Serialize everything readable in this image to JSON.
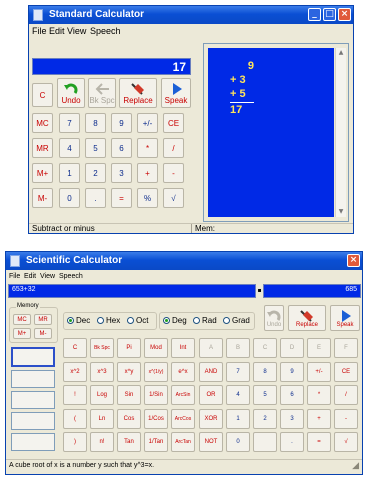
{
  "standard": {
    "title": "Standard Calculator",
    "menu": [
      "File",
      "Edit",
      "View",
      "Speech"
    ],
    "display_value": "17",
    "buttons": {
      "c": "C",
      "undo": "Undo",
      "bkspc": "Bk Spc",
      "replace": "Replace",
      "speak": "Speak",
      "mc": "MC",
      "mr": "MR",
      "mplus": "M+",
      "mminus": "M-",
      "n7": "7",
      "n8": "8",
      "n9": "9",
      "pm": "+/-",
      "ce": "CE",
      "n4": "4",
      "n5": "5",
      "n6": "6",
      "mul": "*",
      "div": "/",
      "n1": "1",
      "n2": "2",
      "n3": "3",
      "add": "+",
      "sub": "-",
      "n0": "0",
      "dot": ".",
      "eq": "=",
      "pct": "%",
      "sqrt": "√"
    },
    "tape": [
      "9",
      "+ 3",
      "+ 5",
      "17"
    ],
    "status_left": "Subtract or minus",
    "status_mem": "Mem:"
  },
  "scientific": {
    "title": "Scientific Calculator",
    "menu": [
      "File",
      "Edit",
      "View",
      "Speech"
    ],
    "expression": "653+32",
    "result": "685",
    "memory_label": "Memory",
    "mem_buttons": [
      "MC",
      "MR",
      "M+",
      "M-"
    ],
    "radix": [
      "Dec",
      "Hex",
      "Oct"
    ],
    "angle": [
      "Deg",
      "Rad",
      "Grad"
    ],
    "icon_buttons": {
      "undo": "Undo",
      "replace": "Replace",
      "speak": "Speak"
    },
    "grid": [
      [
        "C",
        "Bk Spc",
        "Pi",
        "Mod",
        "Int",
        "A",
        "B",
        "C",
        "D",
        "E",
        "F"
      ],
      [
        "x^2",
        "x^3",
        "x^y",
        "x^(1/y)",
        "e^x",
        "AND",
        "7",
        "8",
        "9",
        "+/-",
        "CE"
      ],
      [
        "!",
        "Log",
        "Sin",
        "1/Sin",
        "ArcSin",
        "OR",
        "4",
        "5",
        "6",
        "*",
        "/"
      ],
      [
        "(",
        "Ln",
        "Cos",
        "1/Cos",
        "ArcCos",
        "XOR",
        "1",
        "2",
        "3",
        "+",
        "-"
      ],
      [
        ")",
        "n!",
        "Tan",
        "1/Tan",
        "ArcTan",
        "NOT",
        "0",
        "",
        ".",
        "=",
        "√"
      ]
    ],
    "status": "A cube root of x is a number y such that y^3=x."
  }
}
